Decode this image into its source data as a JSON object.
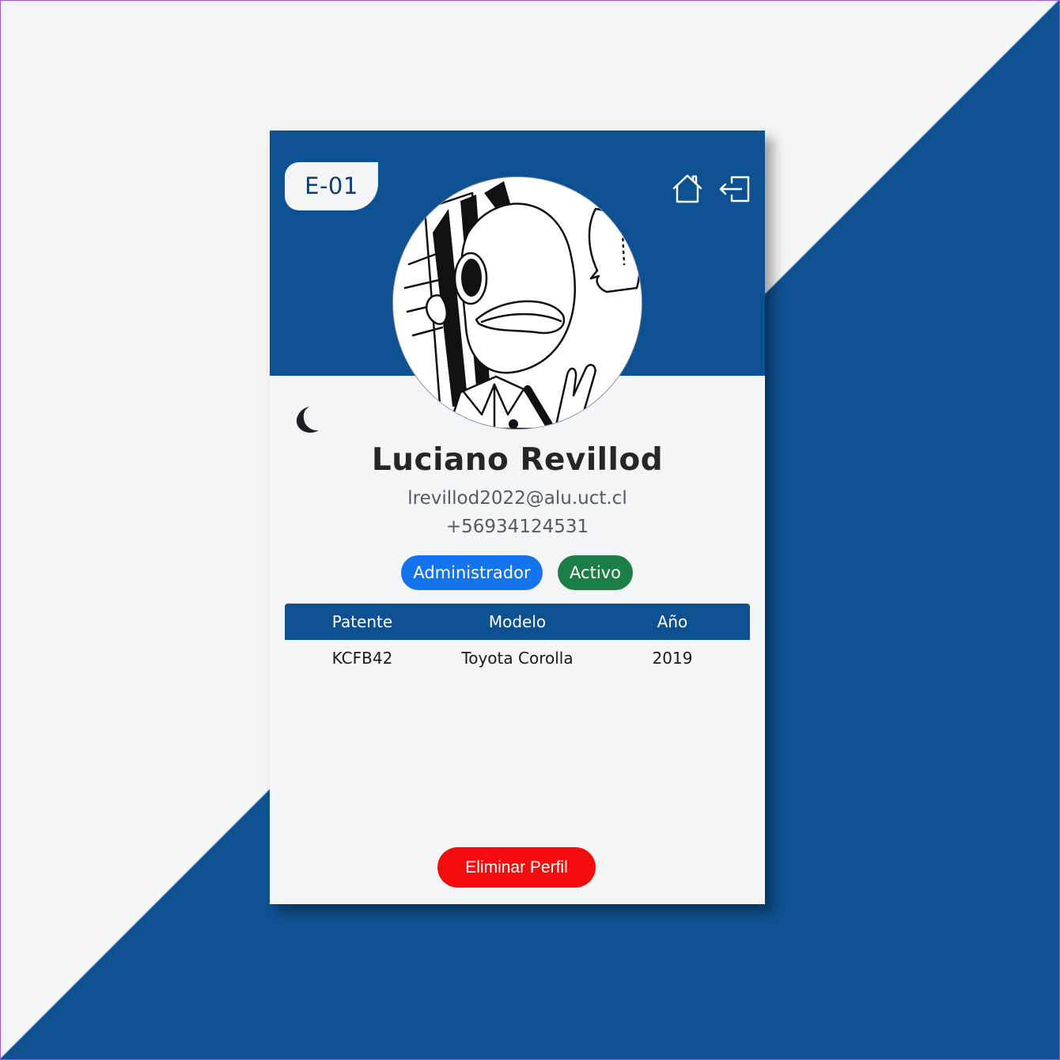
{
  "profile": {
    "code": "E-01",
    "name": "Luciano Revillod",
    "email": "lrevillod2022@alu.uct.cl",
    "phone": "+56934124531",
    "role": "Administrador",
    "status": "Activo"
  },
  "header": {
    "icons": [
      "home-icon",
      "logout-icon"
    ]
  },
  "theme_toggle": {
    "icon": "moon-icon"
  },
  "vehicles": {
    "columns": [
      "Patente",
      "Modelo",
      "Año"
    ],
    "rows": [
      [
        "KCFB42",
        "Toyota Corolla",
        "2019"
      ]
    ]
  },
  "actions": {
    "delete_label": "Eliminar Perfil"
  },
  "colors": {
    "primary": "#0d5192",
    "background": "#f3f4f5",
    "role_badge": "#1474ee",
    "status_badge": "#1b7e45",
    "danger": "#f50d0d"
  }
}
